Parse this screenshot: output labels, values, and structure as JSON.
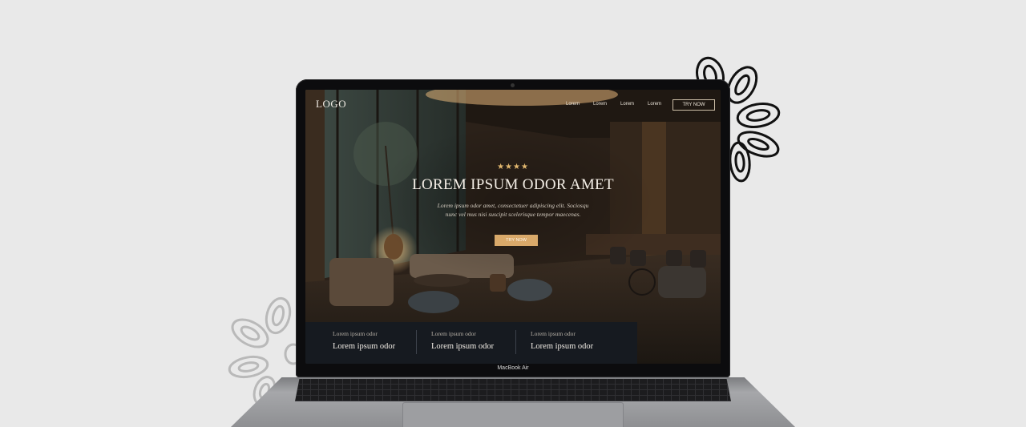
{
  "page": {
    "logo": "LOGO",
    "nav": [
      "Lorem",
      "Lorem",
      "Lorem",
      "Lorem"
    ],
    "cta_top": "TRY NOW",
    "stars": "★★★★",
    "hero_title": "LOREM IPSUM ODOR AMET",
    "hero_subtitle": "Lorem ipsum odor amet, consectetuer adipiscing elit. Sociosqu nunc vel mus nisi suscipit scelerisque tempor maecenas.",
    "cta_hero": "TRY NOW",
    "features": [
      {
        "small": "Lorem ipsum odor",
        "big": "Lorem ipsum odor"
      },
      {
        "small": "Lorem ipsum odor",
        "big": "Lorem ipsum odor"
      },
      {
        "small": "Lorem ipsum odor",
        "big": "Lorem ipsum odor"
      }
    ]
  },
  "device": {
    "label": "MacBook Air"
  },
  "colors": {
    "background": "#e9e9e9",
    "accent": "#d9a96a",
    "stars": "#e3b86f",
    "feature_bar": "#161a20"
  }
}
